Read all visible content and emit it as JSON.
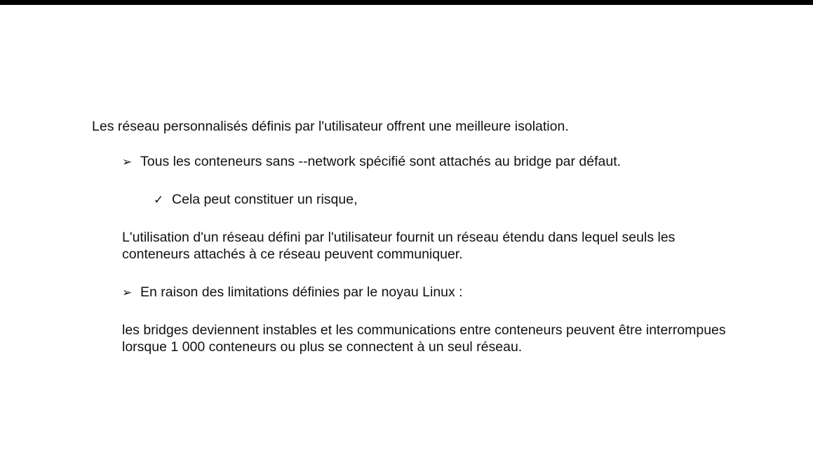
{
  "slide": {
    "intro": "Les réseau personnalisés définis par l'utilisateur offrent une meilleure isolation.",
    "bullet_1": {
      "marker": "➢",
      "text": "Tous les conteneurs sans --network spécifié sont attachés au bridge par défaut."
    },
    "bullet_2": {
      "marker": "✓",
      "text": "Cela peut constituer un risque,"
    },
    "paragraph_1": "L'utilisation d'un réseau défini par l'utilisateur fournit un réseau étendu dans lequel seuls les conteneurs attachés à ce réseau peuvent communiquer.",
    "bullet_3": {
      "marker": "➢",
      "text": "En raison des limitations définies par le noyau Linux :"
    },
    "paragraph_2": "les bridges deviennent instables et les communications entre conteneurs peuvent être interrompues lorsque 1 000 conteneurs ou plus se connectent à un seul réseau."
  }
}
